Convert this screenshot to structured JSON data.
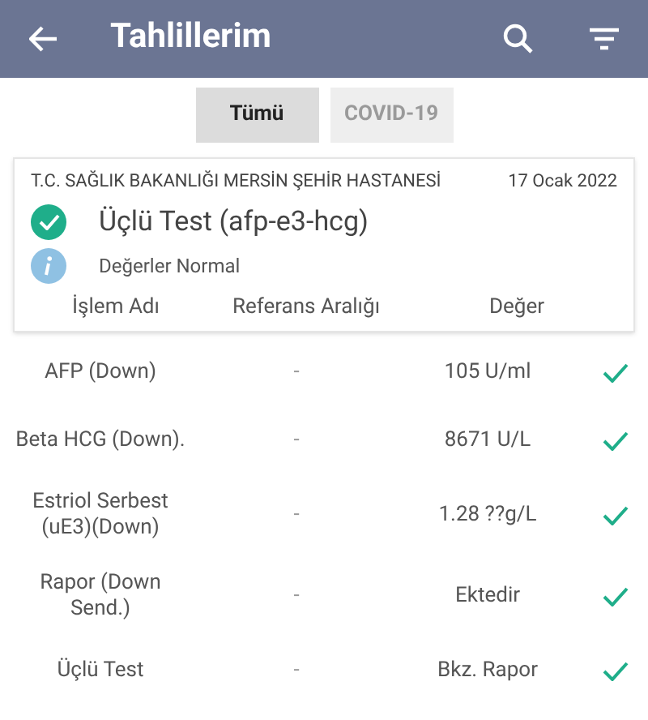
{
  "app_bar": {
    "title": "Tahlillerim"
  },
  "tabs": [
    {
      "label": "Tümü",
      "selected": true
    },
    {
      "label": "COVID-19",
      "selected": false
    }
  ],
  "card": {
    "hospital": "T.C. SAĞLIK BAKANLIĞI MERSİN ŞEHİR HASTANESİ",
    "date": "17 Ocak 2022",
    "test_name": "Üçlü Test (afp-e3-hcg)",
    "completed": true,
    "info": "Değerler Normal",
    "columns": [
      "İşlem Adı",
      "Referans Aralığı",
      "Değer"
    ]
  },
  "rows": [
    {
      "name": "AFP (Down)",
      "reference": "-",
      "value": "105 U/ml",
      "normal": true
    },
    {
      "name": "Beta HCG (Down).",
      "reference": "-",
      "value": "8671 U/L",
      "normal": true
    },
    {
      "name": "Estriol Serbest (uE3)(Down)",
      "reference": "-",
      "value": "1.28 ??g/L",
      "normal": true
    },
    {
      "name": "Rapor (Down Send.)",
      "reference": "-",
      "value": "Ektedir",
      "normal": true
    },
    {
      "name": "Üçlü Test",
      "reference": "-",
      "value": "Bkz. Rapor",
      "normal": true
    }
  ]
}
